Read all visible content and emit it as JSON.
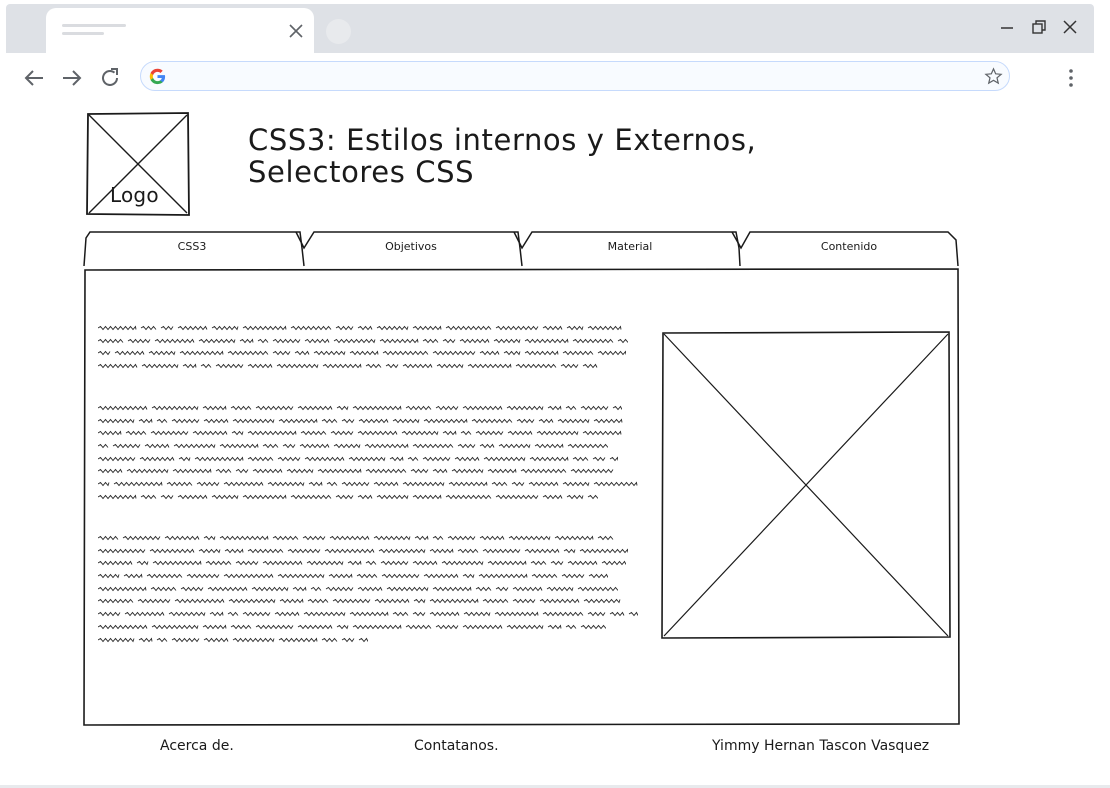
{
  "browser": {
    "tab": {
      "title_lines": 2
    },
    "address_bar": {
      "value": ""
    },
    "icons": [
      "back-icon",
      "forward-icon",
      "reload-icon",
      "google-icon",
      "star-icon",
      "menu-icon",
      "minimize-icon",
      "maximize-icon",
      "close-icon"
    ]
  },
  "header": {
    "logo_label": "Logo",
    "title_line1": "CSS3: Estilos internos y Externos,",
    "title_line2": "Selectores CSS"
  },
  "nav": {
    "tabs": [
      {
        "label": "CSS3"
      },
      {
        "label": "Objetivos"
      },
      {
        "label": "Material"
      },
      {
        "label": "Contenido"
      }
    ]
  },
  "content": {
    "paragraph_line_counts": [
      4,
      8,
      9
    ]
  },
  "footer": {
    "about": "Acerca de.",
    "contact": "Contatanos.",
    "author": "Yimmy Hernan Tascon Vasquez"
  },
  "colors": {
    "stroke": "#1a1a1a",
    "chrome": "#dee1e6",
    "accent": "#c6dafc"
  }
}
